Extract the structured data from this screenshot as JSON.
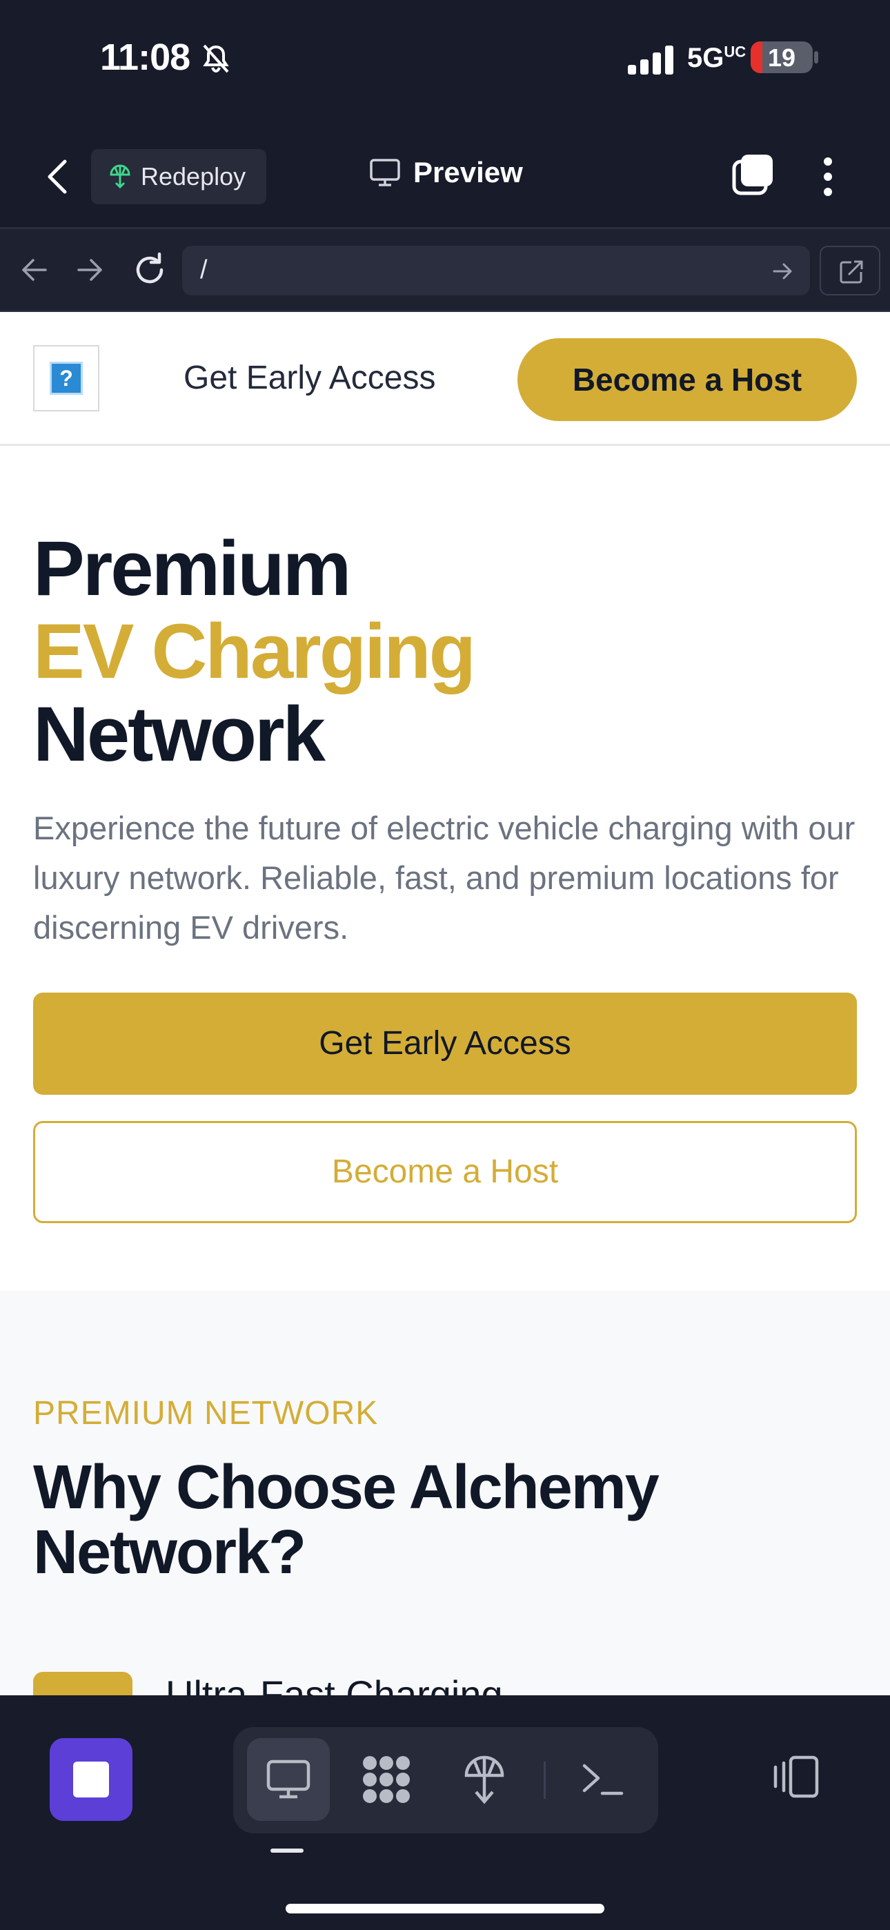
{
  "status_bar": {
    "time": "11:08",
    "network": "5G",
    "network_superscript": "UC",
    "battery": "19",
    "battery_level_percent": 19
  },
  "app_header": {
    "redeploy_label": "Redeploy",
    "preview_label": "Preview"
  },
  "browser": {
    "url": "/"
  },
  "site_nav": {
    "logo_glyph": "?",
    "early_access_link": "Get Early Access",
    "become_host_button": "Become a Host"
  },
  "hero": {
    "title_line1": "Premium",
    "title_line2": "EV Charging",
    "title_line3": "Network",
    "description": "Experience the future of electric vehicle charging with our luxury network. Reliable, fast, and premium locations for discerning EV drivers.",
    "primary_cta": "Get Early Access",
    "secondary_cta": "Become a Host"
  },
  "features": {
    "eyebrow": "PREMIUM NETWORK",
    "heading": "Why Choose Alchemy Network?",
    "first_item_title": "Ultra-Fast Charging"
  },
  "toolbar": {
    "tabs": [
      "monitor-icon",
      "apps-icon",
      "deploy-icon",
      "terminal-icon"
    ],
    "active_tab": "monitor-icon"
  },
  "colors": {
    "accent_gold": "#d4ad37",
    "dark_navy": "#111827",
    "app_chrome": "#171b2a",
    "stop_purple": "#5b3fd6"
  }
}
